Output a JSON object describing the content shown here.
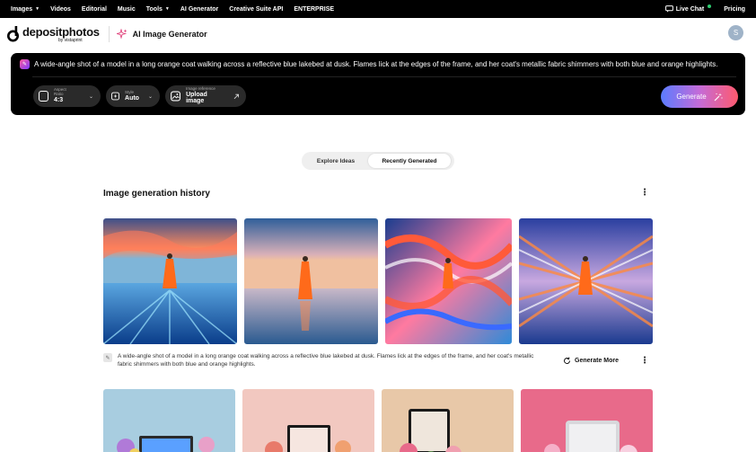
{
  "topnav": {
    "items": [
      {
        "label": "Images",
        "caret": true
      },
      {
        "label": "Videos",
        "caret": false
      },
      {
        "label": "Editorial",
        "caret": false
      },
      {
        "label": "Music",
        "caret": false
      },
      {
        "label": "Tools",
        "caret": true
      },
      {
        "label": "AI Generator",
        "caret": false
      },
      {
        "label": "Creative Suite API",
        "caret": false
      },
      {
        "label": "ENTERPRISE",
        "caret": false
      }
    ],
    "live_chat": "Live Chat",
    "pricing": "Pricing"
  },
  "header": {
    "logo_name": "depositphotos",
    "logo_sub": "by vistaprint",
    "product": "AI Image Generator",
    "avatar_initial": "S"
  },
  "prompt": {
    "text": "A wide-angle shot of a model in a long orange coat walking across a reflective blue lakebed at dusk. Flames lick at the edges of the frame, and her coat's metallic fabric shimmers with both blue and orange highlights.",
    "aspect_label": "Aspect Ratio",
    "aspect_value": "4:3",
    "style_label": "Style",
    "style_value": "Auto",
    "ref_label": "Image reference",
    "ref_value": "Upload image",
    "generate_label": "Generate"
  },
  "tabs": {
    "explore": "Explore Ideas",
    "recent": "Recently Generated"
  },
  "history": {
    "title": "Image generation history",
    "caption": "A wide-angle shot of a model in a long orange coat walking across a reflective blue lakebed at dusk. Flames lick at the edges of the frame, and her coat's metallic fabric shimmers with both blue and orange highlights.",
    "generate_more": "Generate More"
  },
  "colors": {
    "accent_start": "#5b7cff",
    "accent_end": "#ff5a6e",
    "coat": "#ff6a1a"
  }
}
